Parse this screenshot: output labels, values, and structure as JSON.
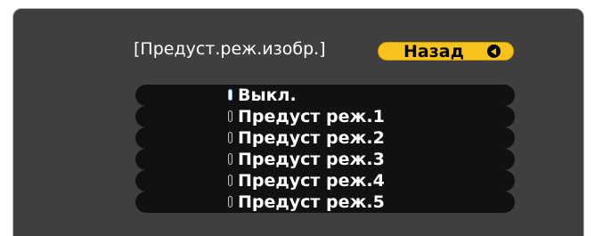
{
  "dialog": {
    "title": "[Предуст.реж.изобр.]",
    "back_label": "Назад",
    "back_icon": "enter-icon",
    "options": [
      {
        "label": "Выкл.",
        "selected": true
      },
      {
        "label": "Предуст реж.1",
        "selected": false
      },
      {
        "label": "Предуст реж.2",
        "selected": false
      },
      {
        "label": "Предуст реж.3",
        "selected": false
      },
      {
        "label": "Предуст реж.4",
        "selected": false
      },
      {
        "label": "Предуст реж.5",
        "selected": false
      }
    ]
  },
  "colors": {
    "panel": "#3f3f3f",
    "button": "#f7c21c",
    "row": "#111111",
    "text": "#ffffff",
    "selected_radio": "#6fa8ff"
  }
}
